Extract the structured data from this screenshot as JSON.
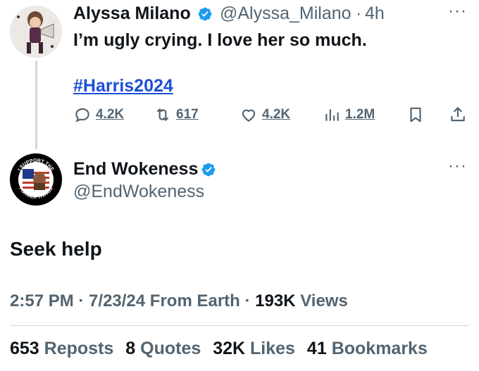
{
  "tweet1": {
    "display_name": "Alyssa Milano",
    "handle": "@Alyssa_Milano",
    "separator": "·",
    "time": "4h",
    "more": "···",
    "text": "I’m ugly crying. I love her so much.",
    "hashtag": "#Harris2024",
    "actions": {
      "replies": "4.2K",
      "reposts": "617",
      "likes": "4.2K",
      "views": "1.2M"
    }
  },
  "tweet2": {
    "display_name": "End Wokeness",
    "handle": "@EndWokeness",
    "more": "···",
    "avatar_text": {
      "top": "I SUPPORT THE",
      "bottom": "FORMER THINGS"
    },
    "text": "Seek help",
    "time": "2:57 PM",
    "date": "7/23/24",
    "source": "From Earth",
    "views_count": "193K",
    "views_label": "Views",
    "stats": {
      "reposts_count": "653",
      "reposts_label": "Reposts",
      "quotes_count": "8",
      "quotes_label": "Quotes",
      "likes_count": "32K",
      "likes_label": "Likes",
      "bookmarks_count": "41",
      "bookmarks_label": "Bookmarks"
    }
  },
  "colors": {
    "text": "#0f1419",
    "muted": "#536471",
    "verified": "#1d9bf0",
    "hashtag": "#1d4ed8"
  },
  "icons": [
    "reply-icon",
    "repost-icon",
    "like-icon",
    "views-icon",
    "bookmark-icon",
    "share-icon",
    "verified-icon",
    "more-icon"
  ]
}
